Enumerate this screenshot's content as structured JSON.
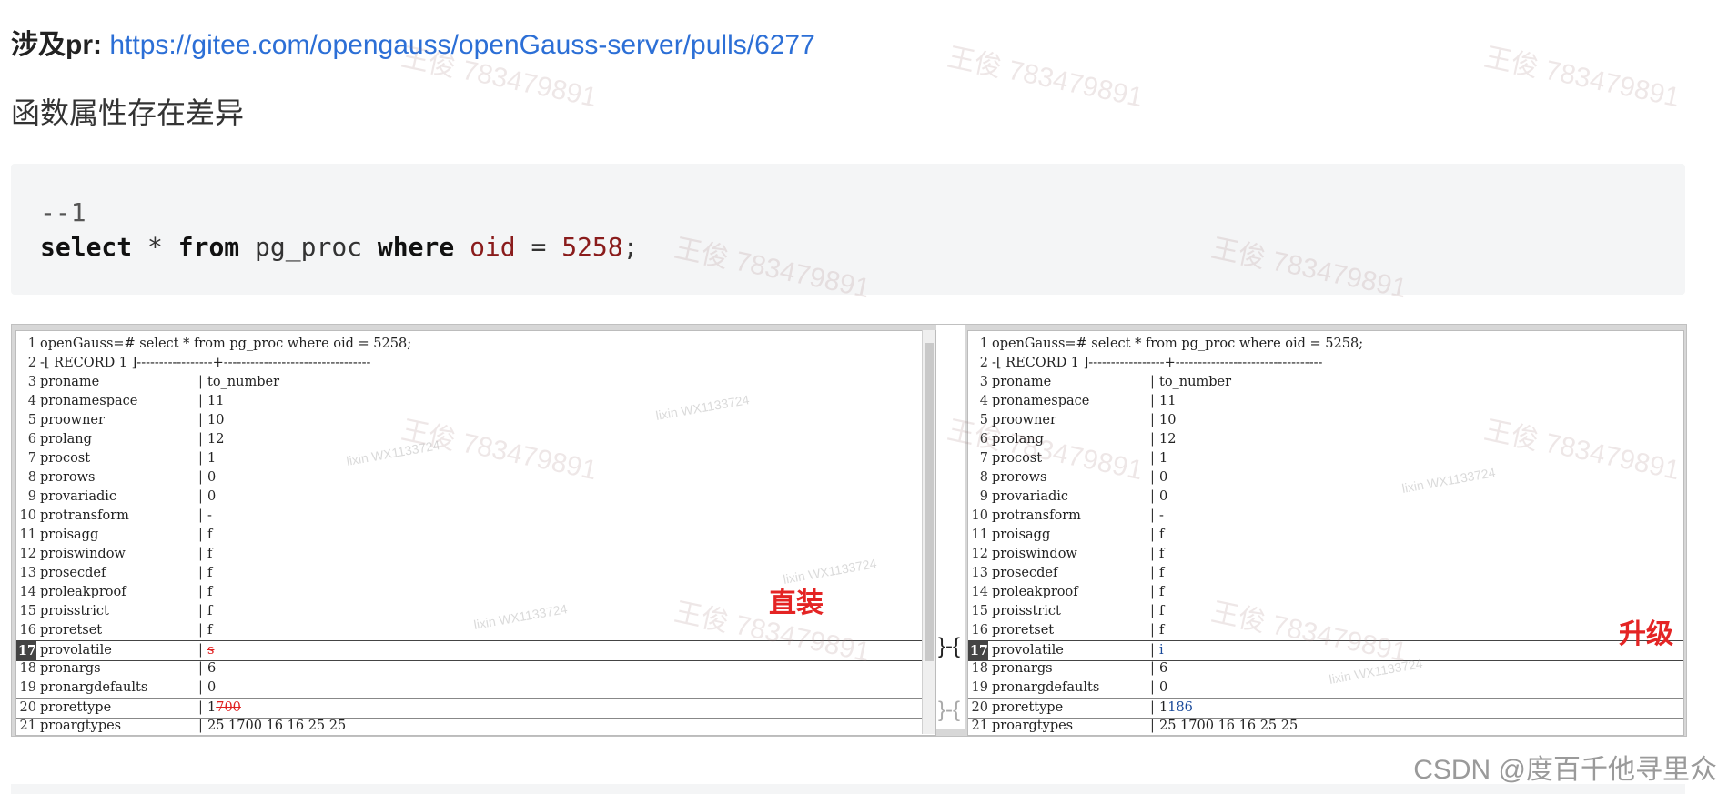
{
  "pr": {
    "label": "涉及pr:",
    "url": "https://gitee.com/opengauss/openGauss-server/pulls/6277"
  },
  "section_title": "函数属性存在差异",
  "code": {
    "comment": "--1",
    "kw_select": "select",
    "star": "*",
    "kw_from": "from",
    "table": "pg_proc",
    "kw_where": "where",
    "col": "oid",
    "eq": "=",
    "value": "5258",
    "semi": ";"
  },
  "left_pane": {
    "tag": "直装",
    "rows": [
      {
        "ln": "1",
        "full": "openGauss=# select * from pg_proc where oid = 5258;"
      },
      {
        "ln": "2",
        "full": "-[ RECORD 1 ]-----------------+---------------------------------"
      },
      {
        "ln": "3",
        "name": "proname",
        "val": "to_number"
      },
      {
        "ln": "4",
        "name": "pronamespace",
        "val": "11"
      },
      {
        "ln": "5",
        "name": "proowner",
        "val": "10"
      },
      {
        "ln": "6",
        "name": "prolang",
        "val": "12"
      },
      {
        "ln": "7",
        "name": "procost",
        "val": "1"
      },
      {
        "ln": "8",
        "name": "prorows",
        "val": "0"
      },
      {
        "ln": "9",
        "name": "provariadic",
        "val": "0"
      },
      {
        "ln": "10",
        "name": "protransform",
        "val": "-"
      },
      {
        "ln": "11",
        "name": "proisagg",
        "val": "f"
      },
      {
        "ln": "12",
        "name": "proiswindow",
        "val": "f"
      },
      {
        "ln": "13",
        "name": "prosecdef",
        "val": "f"
      },
      {
        "ln": "14",
        "name": "proleakproof",
        "val": "f"
      },
      {
        "ln": "15",
        "name": "proisstrict",
        "val": "f"
      },
      {
        "ln": "16",
        "name": "proretset",
        "val": "f"
      },
      {
        "ln": "17",
        "name": "provolatile",
        "val": "s"
      },
      {
        "ln": "18",
        "name": "pronargs",
        "val": "6"
      },
      {
        "ln": "19",
        "name": "pronargdefaults",
        "val": "0"
      },
      {
        "ln": "20",
        "name": "prorettype",
        "val_a": "1",
        "val_b": "700"
      },
      {
        "ln": "21",
        "name": "proargtypes",
        "val": "25 1700 16 16 25 25"
      }
    ]
  },
  "right_pane": {
    "tag": "升级",
    "rows": [
      {
        "ln": "1",
        "full": "openGauss=# select * from pg_proc where oid = 5258;"
      },
      {
        "ln": "2",
        "full": "-[ RECORD 1 ]-----------------+---------------------------------"
      },
      {
        "ln": "3",
        "name": "proname",
        "val": "to_number"
      },
      {
        "ln": "4",
        "name": "pronamespace",
        "val": "11"
      },
      {
        "ln": "5",
        "name": "proowner",
        "val": "10"
      },
      {
        "ln": "6",
        "name": "prolang",
        "val": "12"
      },
      {
        "ln": "7",
        "name": "procost",
        "val": "1"
      },
      {
        "ln": "8",
        "name": "prorows",
        "val": "0"
      },
      {
        "ln": "9",
        "name": "provariadic",
        "val": "0"
      },
      {
        "ln": "10",
        "name": "protransform",
        "val": "-"
      },
      {
        "ln": "11",
        "name": "proisagg",
        "val": "f"
      },
      {
        "ln": "12",
        "name": "proiswindow",
        "val": "f"
      },
      {
        "ln": "13",
        "name": "prosecdef",
        "val": "f"
      },
      {
        "ln": "14",
        "name": "proleakproof",
        "val": "f"
      },
      {
        "ln": "15",
        "name": "proisstrict",
        "val": "f"
      },
      {
        "ln": "16",
        "name": "proretset",
        "val": "f"
      },
      {
        "ln": "17",
        "name": "provolatile",
        "val": "i"
      },
      {
        "ln": "18",
        "name": "pronargs",
        "val": "6"
      },
      {
        "ln": "19",
        "name": "pronargdefaults",
        "val": "0"
      },
      {
        "ln": "20",
        "name": "prorettype",
        "val_a": "1",
        "val_b": "186"
      },
      {
        "ln": "21",
        "name": "proargtypes",
        "val": "25 1700 16 16 25 25"
      }
    ]
  },
  "watermarks": {
    "main": "王俊 783479891",
    "small": "lixin WX1133724"
  },
  "footer": "CSDN @度百千他寻里众"
}
